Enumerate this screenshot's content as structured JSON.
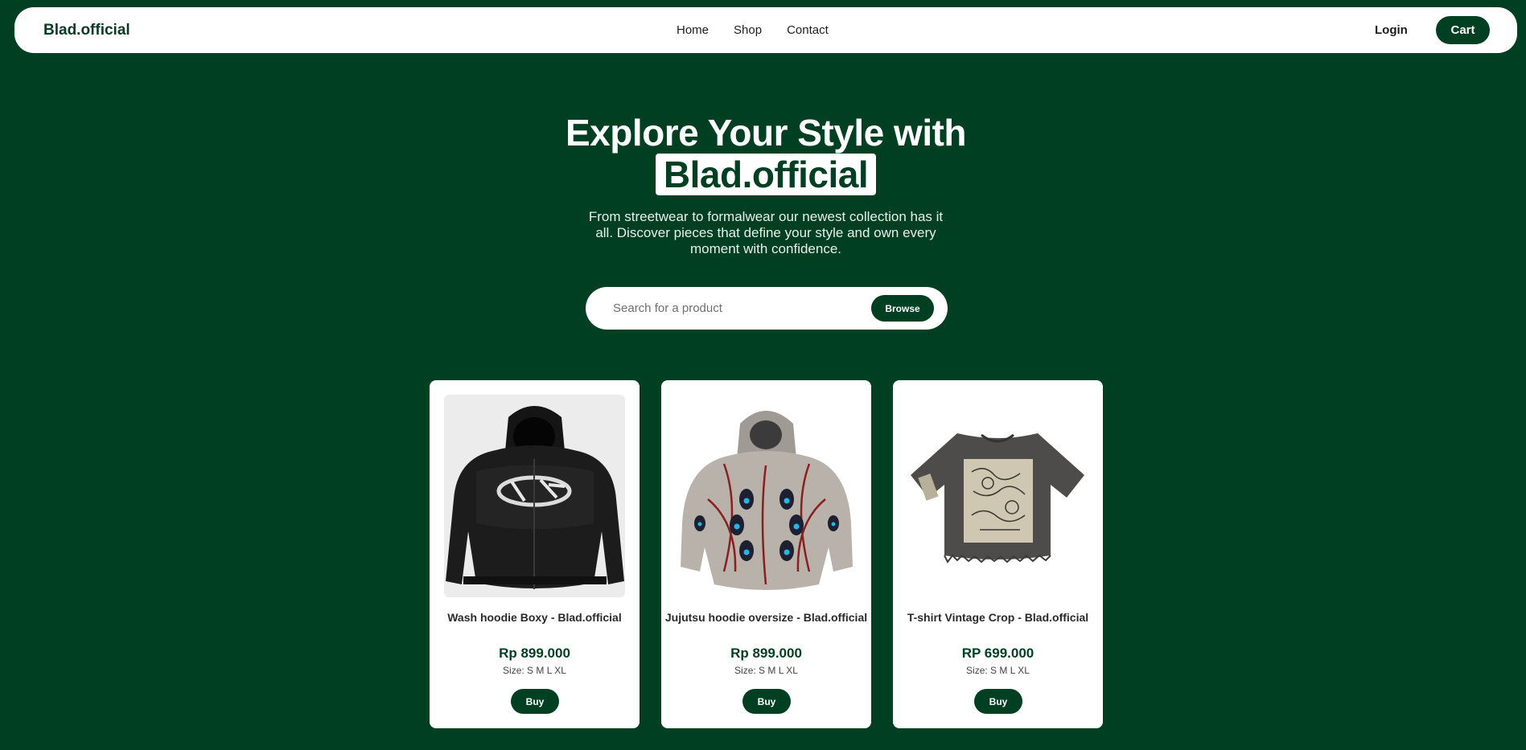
{
  "navbar": {
    "brand": "Blad.official",
    "links": [
      "Home",
      "Shop",
      "Contact"
    ],
    "login_label": "Login",
    "cart_label": "Cart"
  },
  "hero": {
    "title_line1": "Explore Your Style with",
    "title_brand": "Blad.official",
    "description": "From streetwear to formalwear our newest collection has it all. Discover pieces that define your style and own every moment with confidence."
  },
  "search": {
    "placeholder": "Search for a product",
    "value": "",
    "button_label": "Browse"
  },
  "products": [
    {
      "name": "Wash hoodie Boxy - Blad.official",
      "price": "Rp 899.000",
      "sizes": "Size: S M L XL",
      "buy_label": "Buy",
      "image": "black-zip-hoodie-image"
    },
    {
      "name": "Jujutsu hoodie oversize - Blad.official",
      "price": "Rp 899.000",
      "sizes": "Size: S M L XL",
      "buy_label": "Buy",
      "image": "gray-eyes-hoodie-image"
    },
    {
      "name": "T-shirt Vintage Crop - Blad.official",
      "price": "RP 699.000",
      "sizes": "Size: S M L XL",
      "buy_label": "Buy",
      "image": "vintage-crop-tshirt-image"
    }
  ],
  "colors": {
    "background": "#003f22",
    "accent": "#003f22",
    "surface": "#ffffff"
  }
}
